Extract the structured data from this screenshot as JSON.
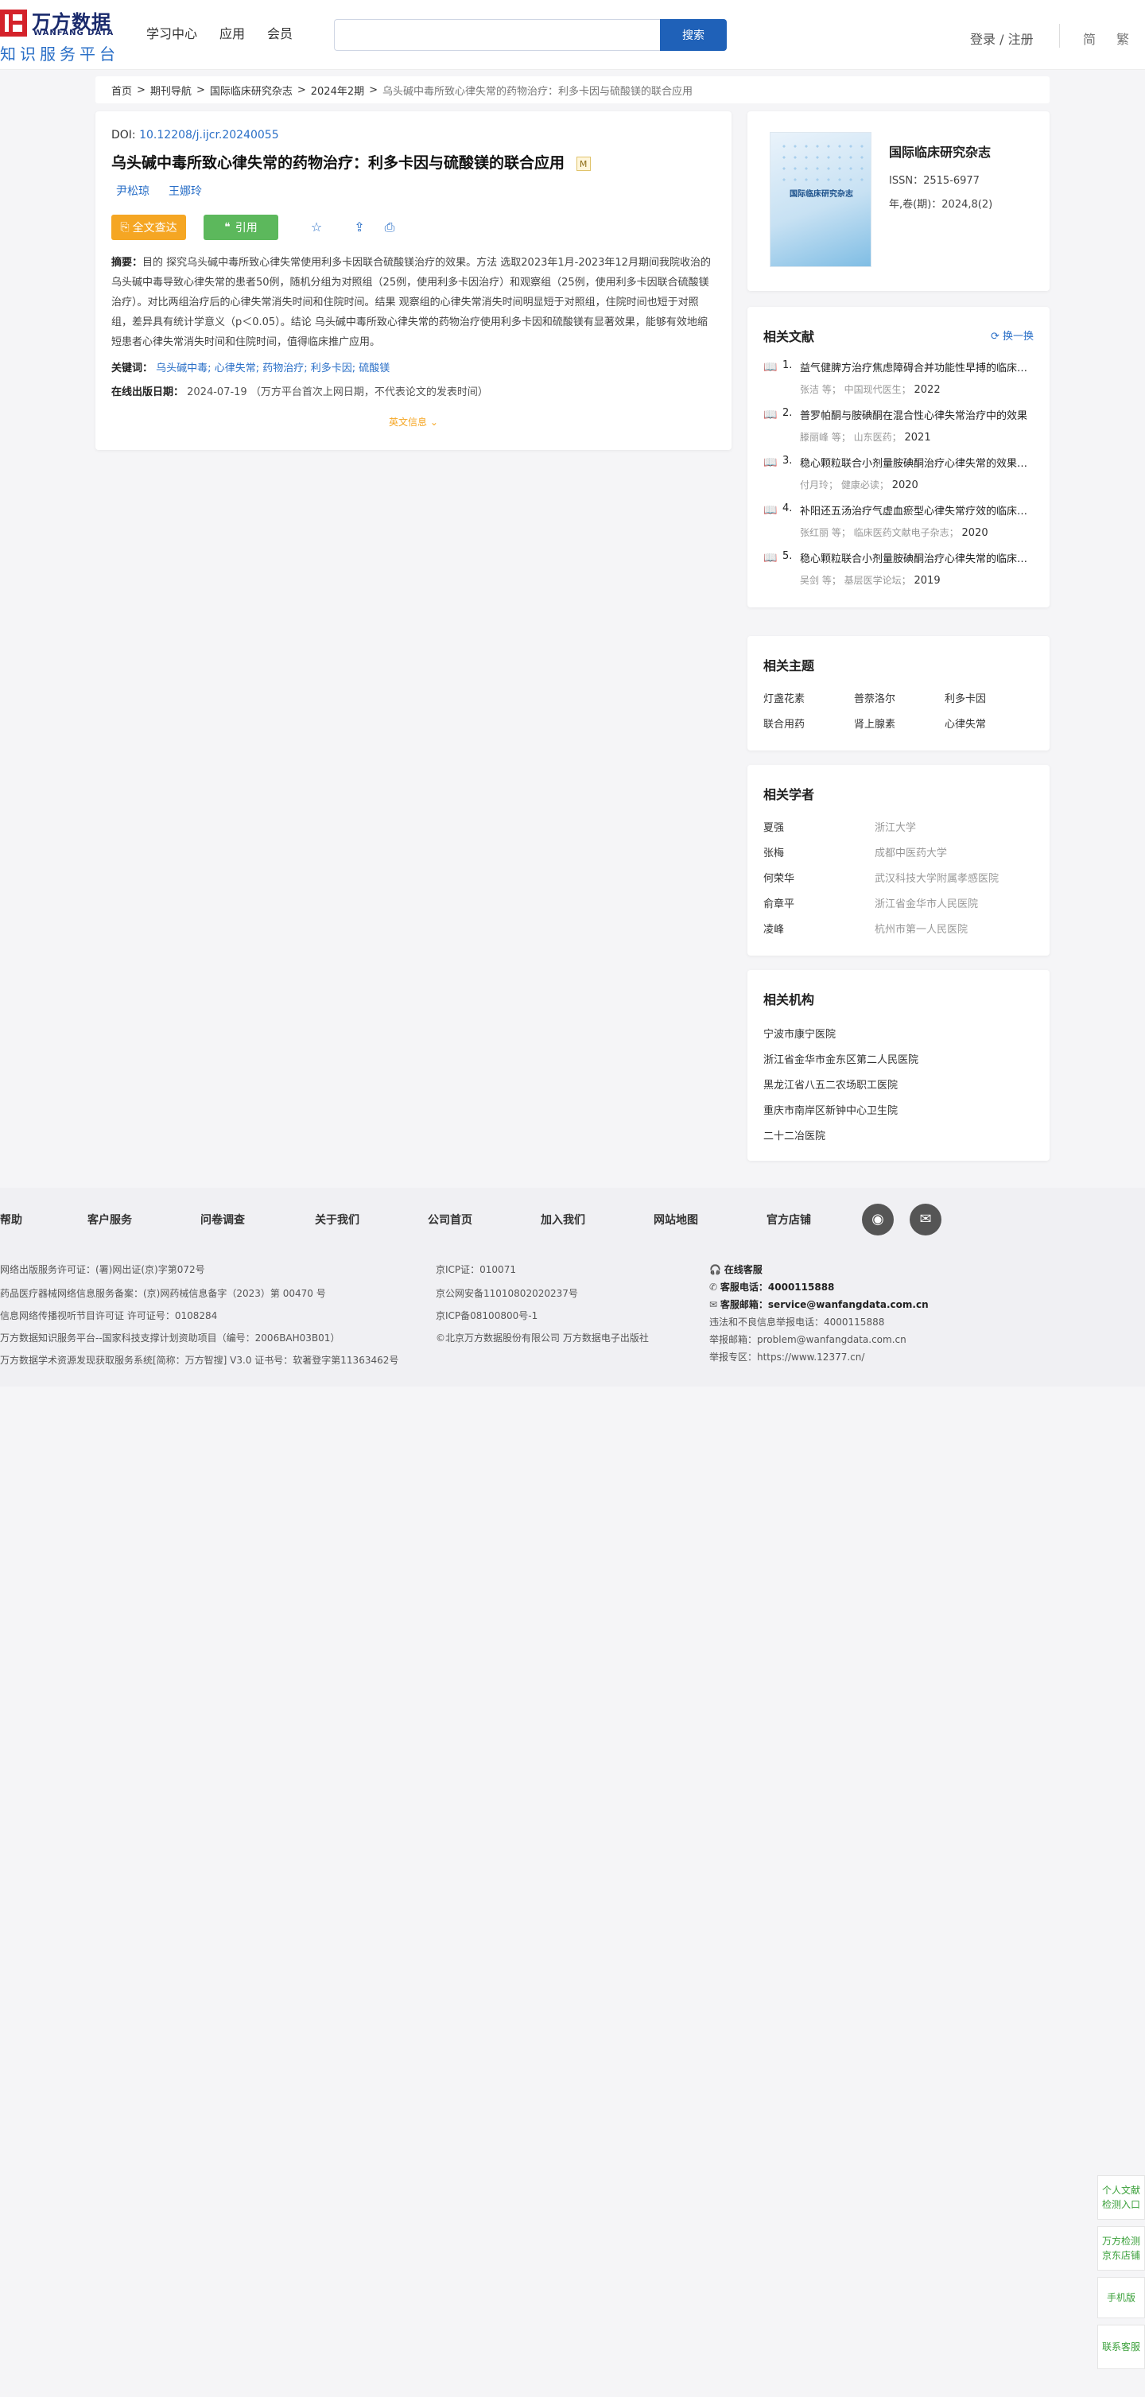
{
  "header": {
    "logo_cn": "万方数据",
    "logo_en": "WANFANG DATA",
    "logo_sub": "知识服务平台",
    "nav": [
      "学习中心",
      "应用",
      "会员"
    ],
    "search_placeholder": "",
    "search_button": "搜索",
    "login": "登录 / 注册",
    "lang_simplified": "简",
    "lang_traditional": "繁"
  },
  "breadcrumb": {
    "items": [
      "首页",
      "期刊导航",
      "国际临床研究杂志",
      "2024年2期"
    ],
    "separator": ">",
    "current": "乌头碱中毒所致心律失常的药物治疗：利多卡因与硫酸镁的联合应用"
  },
  "article": {
    "doi_label": "DOI:",
    "doi": "10.12208/j.ijcr.20240055",
    "title": "乌头碱中毒所致心律失常的药物治疗：利多卡因与硫酸镁的联合应用",
    "badge": "M",
    "authors": [
      "尹松琼",
      "王娜玲"
    ],
    "btn_fulltext": "全文查达",
    "btn_cite": "引用",
    "abstract_label": "摘要：",
    "abstract": "目的 探究乌头碱中毒所致心律失常使用利多卡因联合硫酸镁治疗的效果。方法 选取2023年1月-2023年12月期间我院收治的乌头碱中毒导致心律失常的患者50例，随机分组为对照组（25例，使用利多卡因治疗）和观察组（25例，使用利多卡因联合硫酸镁治疗）。对比两组治疗后的心律失常消失时间和住院时间。结果 观察组的心律失常消失时间明显短于对照组，住院时间也短于对照组，差异具有统计学意义（p＜0.05）。结论 乌头碱中毒所致心律失常的药物治疗使用利多卡因和硫酸镁有显著效果，能够有效地缩短患者心律失常消失时间和住院时间，值得临床推广应用。",
    "keywords_label": "关键词：",
    "keywords": [
      "乌头碱中毒;",
      "心律失常;",
      "药物治疗;",
      "利多卡因;",
      "硫酸镁"
    ],
    "pubdate_label": "在线出版日期：",
    "pubdate": "2024-07-19",
    "pubdate_note": "（万方平台首次上网日期，不代表论文的发表时间）",
    "en_info": "英文信息"
  },
  "journal": {
    "cover_title": "国际临床研究杂志",
    "name": "国际临床研究杂志",
    "issn": "ISSN：2515-6977",
    "vol": "年,卷(期)：2024,8(2)"
  },
  "related_lit": {
    "title": "相关文献",
    "refresh": "换一换",
    "items": [
      {
        "num": "1.",
        "title": "益气健脾方治疗焦虑障碍合并功能性早搏的临床观察",
        "authors": "张洁 等",
        "source": "中国现代医生",
        "year": "2022"
      },
      {
        "num": "2.",
        "title": "普罗帕酮与胺碘酮在混合性心律失常治疗中的效果",
        "authors": "滕丽峰 等",
        "source": "山东医药",
        "year": "2021"
      },
      {
        "num": "3.",
        "title": "稳心颗粒联合小剂量胺碘酮治疗心律失常的效果观察",
        "authors": "付月玲",
        "source": "健康必读",
        "year": "2020"
      },
      {
        "num": "4.",
        "title": "补阳还五汤治疗气虚血瘀型心律失常疗效的临床观察",
        "authors": "张红丽 等",
        "source": "临床医药文献电子杂志",
        "year": "2020"
      },
      {
        "num": "5.",
        "title": "稳心颗粒联合小剂量胺碘酮治疗心律失常的临床观察",
        "authors": "吴剑 等",
        "source": "基层医学论坛",
        "year": "2019"
      }
    ]
  },
  "related_topics": {
    "title": "相关主题",
    "items": [
      "灯盏花素",
      "普萘洛尔",
      "利多卡因",
      "联合用药",
      "肾上腺素",
      "心律失常"
    ]
  },
  "related_scholars": {
    "title": "相关学者",
    "items": [
      {
        "name": "夏强",
        "org": "浙江大学"
      },
      {
        "name": "张梅",
        "org": "成都中医药大学"
      },
      {
        "name": "何荣华",
        "org": "武汉科技大学附属孝感医院"
      },
      {
        "name": "俞章平",
        "org": "浙江省金华市人民医院"
      },
      {
        "name": "凌峰",
        "org": "杭州市第一人民医院"
      }
    ]
  },
  "related_insts": {
    "title": "相关机构",
    "items": [
      "宁波市康宁医院",
      "浙江省金华市金东区第二人民医院",
      "黑龙江省八五二农场职工医院",
      "重庆市南岸区新钟中心卫生院",
      "二十二冶医院"
    ]
  },
  "footer": {
    "nav": [
      "帮助",
      "客户服务",
      "问卷调查",
      "关于我们",
      "公司首页",
      "加入我们",
      "网站地图",
      "官方店铺"
    ],
    "social": [
      "weibo-icon",
      "wechat-icon"
    ],
    "col1": [
      "网络出版服务许可证：(署)网出证(京)字第072号",
      "药品医疗器械网络信息服务备案：(京)网药械信息备字（2023）第 00470 号",
      "信息网络传播视听节目许可证 许可证号：0108284",
      "万方数据知识服务平台--国家科技支撑计划资助项目（编号：2006BAH03B01）",
      "万方数据学术资源发现获取服务系统[简称：万方智搜] V3.0 证书号：软著登字第11363462号"
    ],
    "col2": [
      "京ICP证：010071",
      "京公网安备11010802020237号",
      "京ICP备08100800号-1",
      "©北京万方数据股份有限公司 万方数据电子出版社"
    ],
    "col3": {
      "online": "在线客服",
      "phone_label": "客服电话：",
      "phone": "4000115888",
      "email_label": "客服邮箱：",
      "email": "service@wanfangdata.com.cn",
      "report_phone": "违法和不良信息举报电话：4000115888",
      "report_email": "举报邮箱：problem@wanfangdata.com.cn",
      "report_zone": "举报专区：https://www.12377.cn/"
    }
  },
  "float_panel": [
    "个人文献检测入口",
    "万方检测京东店铺",
    "手机版",
    "联系客服"
  ],
  "colors": {
    "brand_blue": "#1f61b8",
    "link_blue": "#2a6fc7",
    "orange": "#f5a623",
    "green": "#5cb85c",
    "logo_red": "#d4222a"
  }
}
